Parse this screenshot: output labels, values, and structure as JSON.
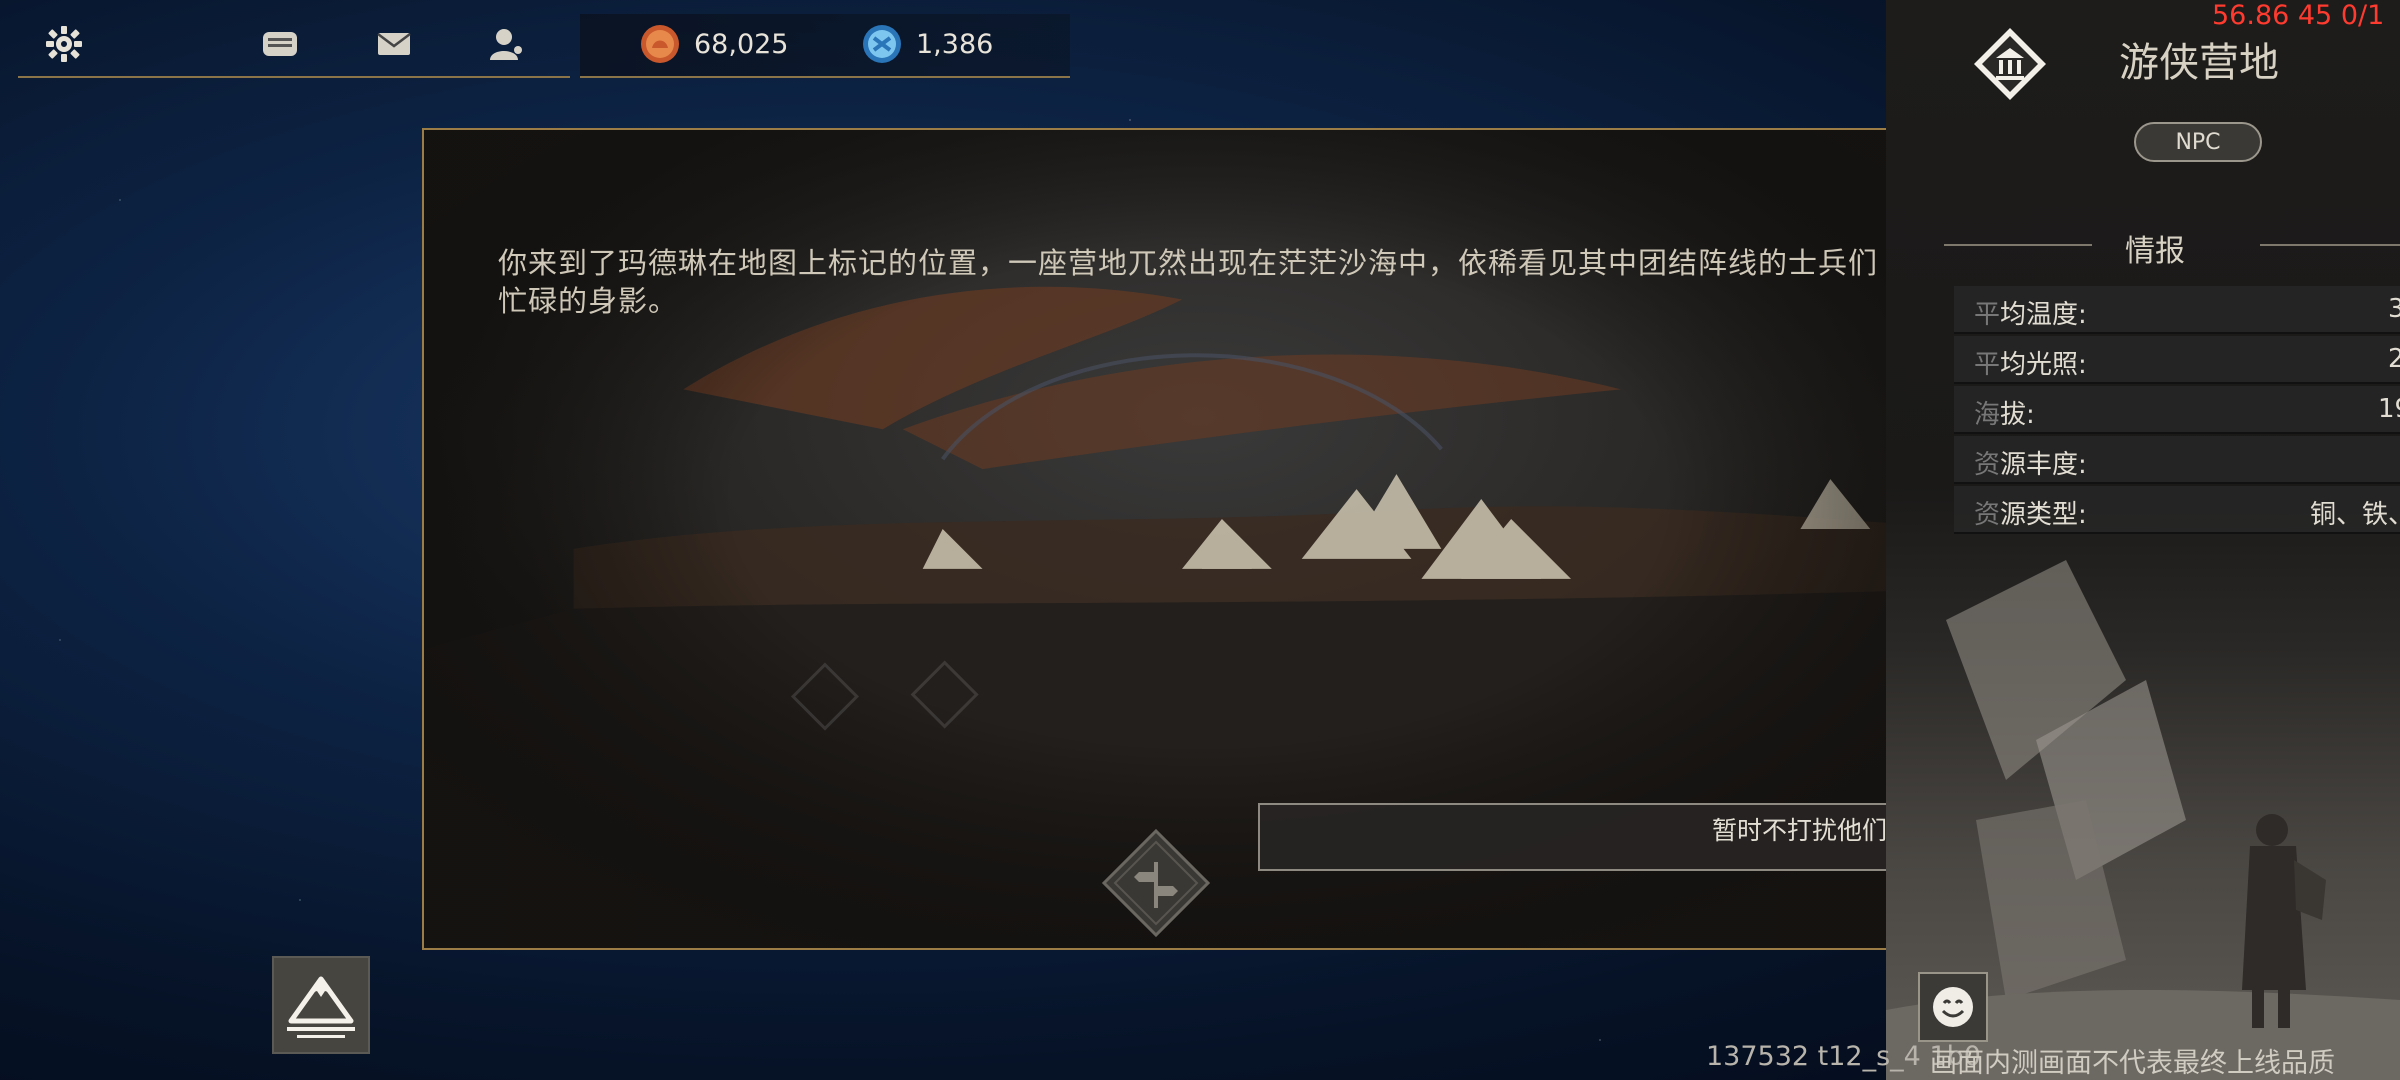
{
  "topbar": {
    "icons": [
      "gear-icon",
      "chat-icon",
      "mail-icon",
      "profile-icon"
    ],
    "resources": [
      {
        "icon": "gold-coin-icon",
        "value": "68,025",
        "color": "#e0703a"
      },
      {
        "icon": "blue-gem-icon",
        "value": "1,386",
        "color": "#4fa7e0"
      }
    ]
  },
  "dialog": {
    "text": "你来到了玛德琳在地图上标记的位置，一座营地兀然出现在茫茫沙海中，依稀看见其中团结阵线的士兵们忙碌的身影。",
    "choice": "暂时不打扰他们。",
    "close_symbol": "✕"
  },
  "panel": {
    "title": "游侠营地",
    "badge": "NPC",
    "section": "情报",
    "rows": [
      {
        "dim": "平",
        "key": "均温度:",
        "value": "3"
      },
      {
        "dim": "平",
        "key": "均光照:",
        "value": "2"
      },
      {
        "dim": "海",
        "key": "拔:",
        "value": "19"
      },
      {
        "dim": "资",
        "key": "源丰度:",
        "value": ""
      },
      {
        "dim": "资",
        "key": "源类型:",
        "value": "铜、铁、"
      }
    ]
  },
  "debug": "56.86 45 0/1",
  "footer": {
    "build": "137532 t12_s_4 1b0",
    "notice": "画面内测画面不代表最终上线品质"
  },
  "colors": {
    "accent": "#e08a28",
    "border_gold": "#9b7d45",
    "debug_red": "#ff3b2f"
  }
}
